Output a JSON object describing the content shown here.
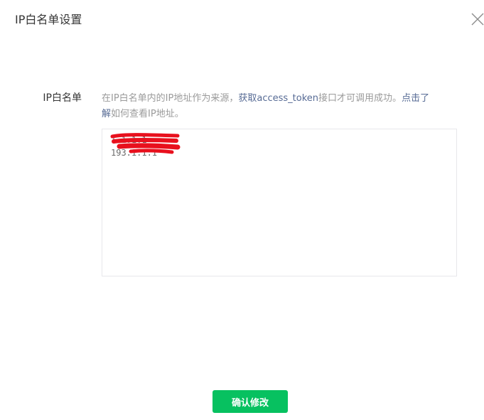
{
  "dialog": {
    "title": "IP白名单设置",
    "close_icon": "close-icon"
  },
  "form": {
    "label": "IP白名单",
    "description": {
      "prefix": "在IP白名单内的IP地址作为来源，",
      "highlight_access": "获取",
      "highlight_token": "access_token",
      "middle": "接口才可调用成功。",
      "link_a": "点击了",
      "link_b": "解",
      "suffix": "如何查看IP地址。"
    },
    "ip_list_value": "1.1.1.1\n193.1.1.1"
  },
  "footer": {
    "confirm_label": "确认修改"
  },
  "colors": {
    "accent_green": "#07c160",
    "link_blue": "#576b95",
    "redaction_red": "#e8101d"
  }
}
